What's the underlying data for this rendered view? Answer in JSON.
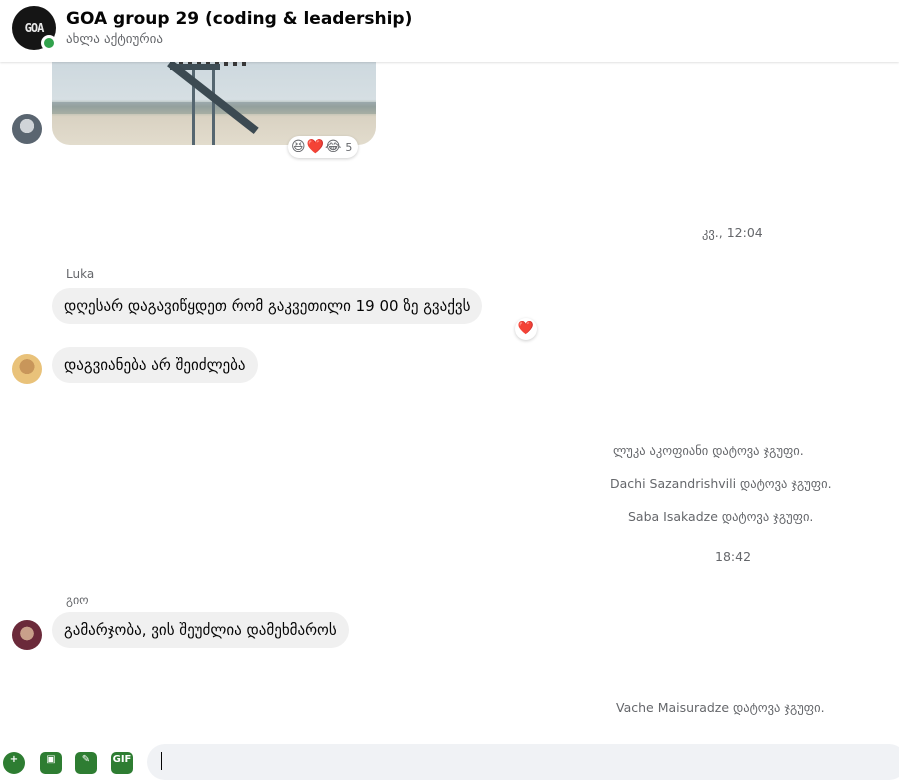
{
  "header": {
    "title": "GOA group 29 (coding & leadership)",
    "status": "ახლა აქტიურია",
    "avatar_text": "GOA"
  },
  "image_message": {
    "reactions": [
      "😆",
      "❤️",
      "😂"
    ],
    "reaction_count": "5"
  },
  "messages": [
    {
      "type": "time",
      "text": "კვ., 12:04"
    },
    {
      "type": "sender",
      "text": "Luka"
    },
    {
      "type": "message",
      "text": "დღესარ დაგავიწყდეთ რომ გაკვეთილი 19 00 ზე გვაქვს",
      "reaction": "❤️"
    },
    {
      "type": "message",
      "text": "დაგვიანება არ შეიძლება"
    },
    {
      "type": "system",
      "text": "ლუკა აკოფიანი დატოვა ჯგუფი."
    },
    {
      "type": "system",
      "text": "Dachi Sazandrishvili დატოვა ჯგუფი."
    },
    {
      "type": "system",
      "text": "Saba Isakadze დატოვა ჯგუფი."
    },
    {
      "type": "time",
      "text": "18:42"
    },
    {
      "type": "sender",
      "text": "გიო"
    },
    {
      "type": "message",
      "text": "გამარჯობა, ვის შეუძლია დამეხმაროს"
    },
    {
      "type": "system",
      "text": "Vache Maisuradze დატოვა ჯგუფი."
    }
  ],
  "composer": {
    "tools": [
      "plus-icon",
      "image-icon",
      "sticker-icon",
      "gif-icon"
    ],
    "gif_label": "GIF"
  },
  "colors": {
    "online": "#31a24c",
    "bubble": "#f0f0f0",
    "secondary_text": "#65676b",
    "tool_green": "#2e7d32"
  }
}
